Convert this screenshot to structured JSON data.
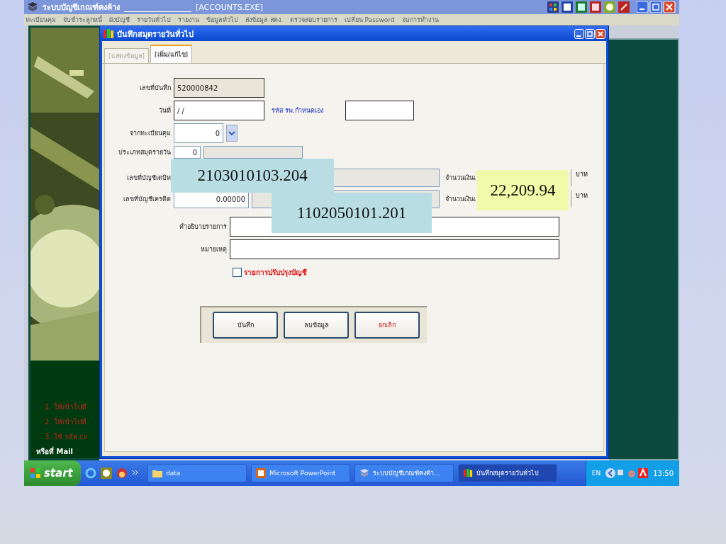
{
  "app_window": {
    "title": "ระบบบัญชีเกณฑ์คงค้าง",
    "exe": "[ACCOUNTS.EXE]",
    "menu": [
      "ทะเบียนคุม",
      "จับชำระลูกหนี้",
      "ผังบัญชี",
      "รายวันทั่วไป",
      "รายงาน",
      "ข้อมูลทั่วไป",
      "ส่งข้อมูล สตง.",
      "ตรวจสอบรายการ",
      "เปลี่ยน Password",
      "จบการทำงาน"
    ]
  },
  "background_notes": [
    {
      "text": "1.  ให้เข้าไปที",
      "kind": "red"
    },
    {
      "text": "2.  ให้เข้าไปที",
      "kind": "red"
    },
    {
      "text": "3.  ใช้ รหัส cv",
      "kind": "red"
    },
    {
      "text": "หรือที่ Mail",
      "kind": "white"
    }
  ],
  "dialog": {
    "title": "บันทึกสมุดรายวันทั่วไป",
    "tabs": [
      {
        "label": "[แสดงข้อมูล]",
        "selected": false
      },
      {
        "label": "[เพิ่ม/แก้ไข]",
        "selected": true
      }
    ],
    "record_no": {
      "label": "เลขที่บันทึก",
      "value": "520000842"
    },
    "date": {
      "label": "วันที่",
      "value": "/ /"
    },
    "hospital_code": {
      "label": "รหัส รพ.กำหนดเอง"
    },
    "register": {
      "label": "จากทะเบียนคุม",
      "value": "0"
    },
    "journal_type": {
      "label": "ประเภทสมุดรายวัน",
      "value": "0"
    },
    "debit": {
      "label": "เลขที่บัญชีเดบิท",
      "amount_label": "จำนวนเงินเ",
      "unit": "บาท"
    },
    "credit": {
      "label": "เลขที่บัญชีเครดิต",
      "value": "0.00000",
      "amount_label": "จำนวนเงินเ",
      "unit": "บาท"
    },
    "description": {
      "label": "คำอธิบายรายการ"
    },
    "remark": {
      "label": "หมายเหตุ"
    },
    "adjustment": {
      "label": "รายการปรับปรุงบัญชี",
      "checked": false
    },
    "buttons": [
      {
        "label": "บันทึก",
        "kind": "normal"
      },
      {
        "label": "ลบข้อมูล",
        "kind": "normal"
      },
      {
        "label": "ยกเลิก",
        "kind": "cancel"
      }
    ]
  },
  "callouts": [
    {
      "text": "2103010103.204",
      "kind": "account"
    },
    {
      "text": "1102050101.201",
      "kind": "account"
    },
    {
      "text": "22,209.94",
      "kind": "amount"
    }
  ],
  "taskbar": {
    "start": "start",
    "tasks": [
      {
        "label": "data",
        "kind": "folder",
        "selected": false
      },
      {
        "label": "Microsoft PowerPoint",
        "kind": "powerpoint",
        "selected": false
      },
      {
        "label": "ระบบบัญชีเกณฑ์คงค้า...",
        "kind": "book",
        "selected": false
      },
      {
        "label": "บันทึกสมุดรายวันทั่วไป",
        "kind": "app",
        "selected": true
      }
    ],
    "language": "EN",
    "time": "13:50"
  }
}
